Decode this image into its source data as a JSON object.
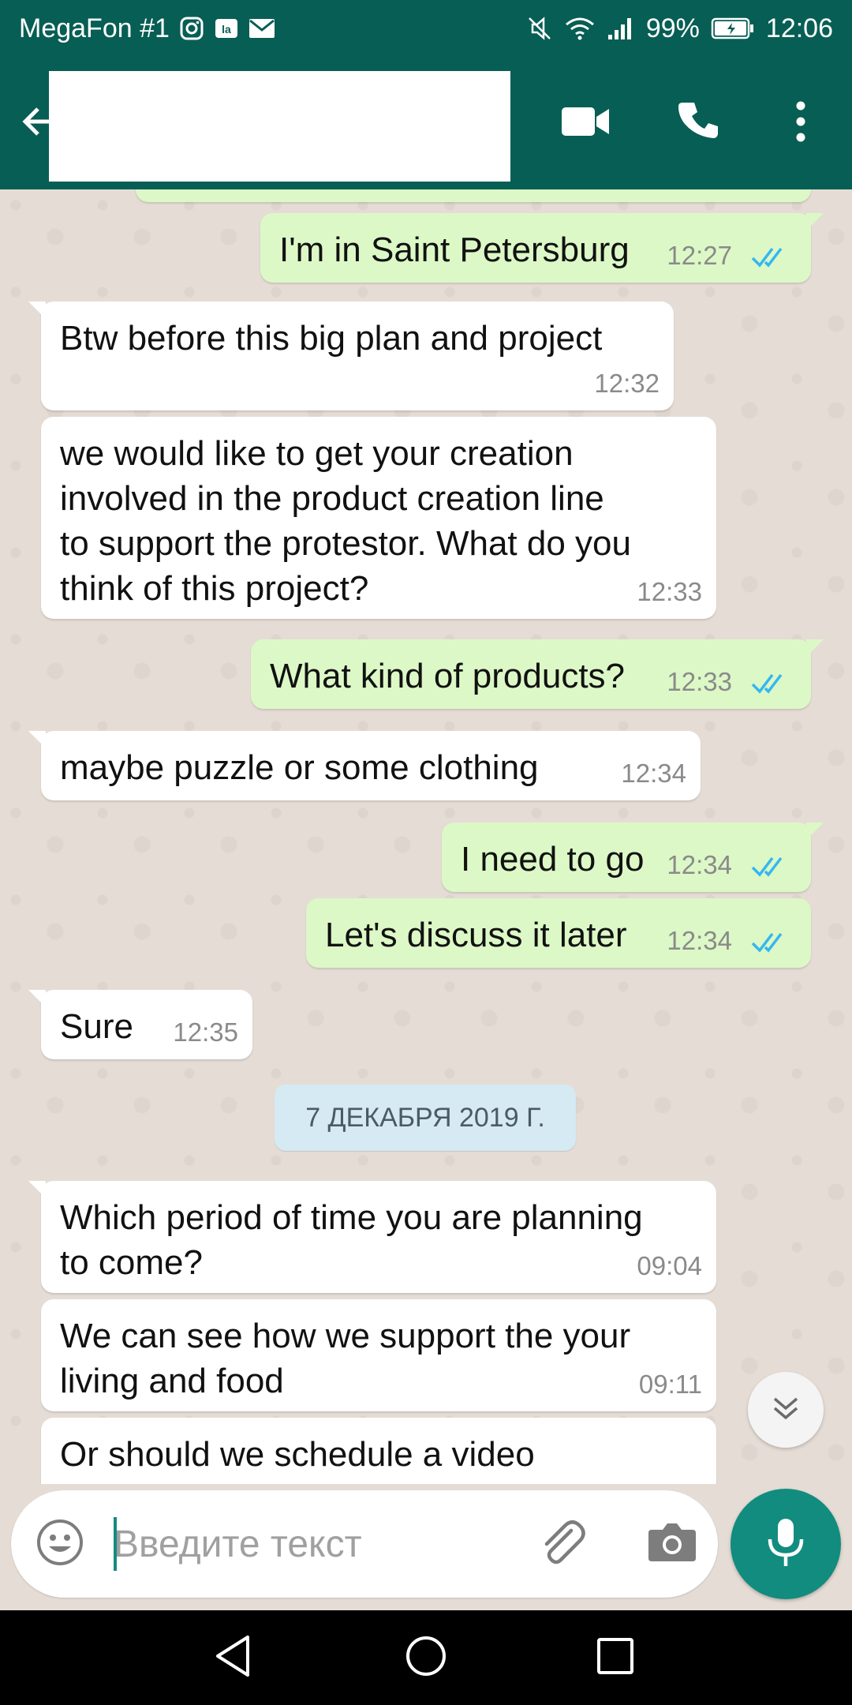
{
  "status_bar": {
    "carrier": "MegaFon #1",
    "battery": "99%",
    "time": "12:06",
    "icons": [
      "instagram-icon",
      "ok-icon",
      "mail-icon",
      "mute-icon",
      "wifi-icon",
      "signal-icon",
      "battery-icon"
    ]
  },
  "header": {
    "icons": [
      "back-arrow-icon",
      "video-call-icon",
      "phone-icon",
      "more-vert-icon"
    ],
    "contact_name": ""
  },
  "messages": [
    {
      "dir": "out",
      "text": "I'm in Saint Petersburg",
      "time": "12:27",
      "read": true
    },
    {
      "dir": "in",
      "text": "Btw before this big plan and project",
      "time": "12:32"
    },
    {
      "dir": "in",
      "lines": [
        "we would like to get your creation",
        "involved in the product creation line",
        "to support the protestor. What do you",
        "think of this project?"
      ],
      "time": "12:33"
    },
    {
      "dir": "out",
      "text": "What kind of products?",
      "time": "12:33",
      "read": true
    },
    {
      "dir": "in",
      "text": "maybe puzzle or some clothing",
      "time": "12:34"
    },
    {
      "dir": "out",
      "text": "I need to go",
      "time": "12:34",
      "read": true
    },
    {
      "dir": "out",
      "text": "Let's discuss it later",
      "time": "12:34",
      "read": true
    },
    {
      "dir": "in",
      "text": "Sure",
      "time": "12:35"
    },
    {
      "dir": "in",
      "lines": [
        "Which period of time you are planning",
        "to come?"
      ],
      "time": "09:04"
    },
    {
      "dir": "in",
      "lines": [
        "We can see how we support the your",
        "living and food"
      ],
      "time": "09:11"
    },
    {
      "dir": "in",
      "text": "Or should we schedule a video"
    }
  ],
  "date_divider": "7 ДЕКАБРЯ 2019 Г.",
  "input": {
    "placeholder": "Введите текст",
    "icons": [
      "emoji-icon",
      "attach-icon",
      "camera-icon",
      "mic-icon"
    ]
  },
  "colors": {
    "header_bg": "#075e54",
    "accent": "#128c7e",
    "outgoing_bubble": "#dcf8c6",
    "incoming_bubble": "#ffffff",
    "read_ticks": "#34b7f1",
    "chat_bg": "#e5ddd5"
  }
}
